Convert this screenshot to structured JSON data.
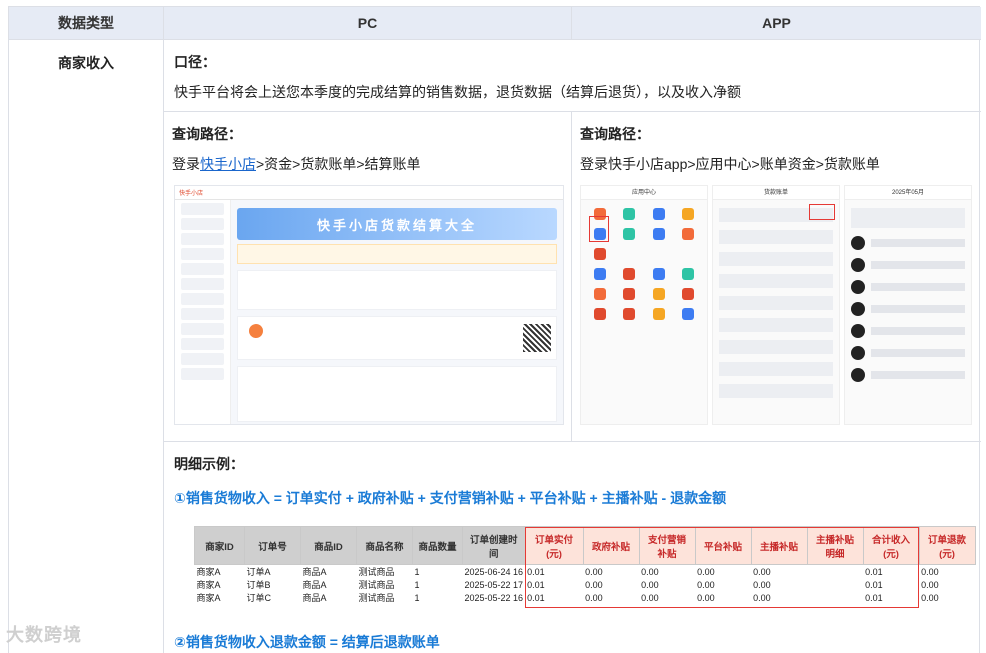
{
  "header": {
    "col1": "数据类型",
    "col2": "PC",
    "col3": "APP"
  },
  "row_label": "商家收入",
  "caliber": {
    "title": "口径：",
    "description": "快手平台将会上送您本季度的完成结算的销售数据，退货数据（结算后退货），以及收入净额"
  },
  "pc": {
    "title": "查询路径：",
    "path_prefix": "登录",
    "path_link": "快手小店",
    "path_rest": ">资金>货款账单>结算账单",
    "screenshot_banner": "快手小店货款结算大全",
    "logo_text": "快手小店"
  },
  "app": {
    "title": "查询路径：",
    "path": "登录快手小店app>应用中心>账单资金>货款账单",
    "screen1_title": "应用中心",
    "screen2_title": "货款账单",
    "screen3_title": "2025年05月"
  },
  "detail": {
    "title": "明细示例：",
    "formula1": "①销售货物收入 = 订单实付 + 政府补贴 + 支付营销补贴 + 平台补贴 + 主播补贴 - 退款金额",
    "formula2": "②销售货物收入退款金额 = 结算后退款账单",
    "table": {
      "headers_gray": [
        "商家ID",
        "订单号",
        "商品ID",
        "商品名称",
        "商品数量",
        "订单创建时间"
      ],
      "headers_pink": [
        "订单实付(元)",
        "政府补贴",
        "支付营销补贴",
        "平台补贴",
        "主播补贴",
        "主播补贴明细",
        "合计收入(元)",
        "订单退款(元)"
      ],
      "rows": [
        [
          "商家A",
          "订单A",
          "商品A",
          "测试商品",
          "1",
          "2025-06-24 16",
          "0.01",
          "0.00",
          "0.00",
          "0.00",
          "0.00",
          "",
          "0.01",
          "0.00"
        ],
        [
          "商家A",
          "订单B",
          "商品A",
          "测试商品",
          "1",
          "2025-05-22 17",
          "0.01",
          "0.00",
          "0.00",
          "0.00",
          "0.00",
          "",
          "0.01",
          "0.00"
        ],
        [
          "商家A",
          "订单C",
          "商品A",
          "测试商品",
          "1",
          "2025-05-22 16",
          "0.01",
          "0.00",
          "0.00",
          "0.00",
          "0.00",
          "",
          "0.01",
          "0.00"
        ]
      ]
    }
  },
  "watermark": "大数跨境",
  "colors": {
    "header_bg": "#e6ebf5",
    "accent_blue": "#1a7bd6",
    "highlight_red": "#e53935",
    "pink_header": "#fde3da"
  }
}
